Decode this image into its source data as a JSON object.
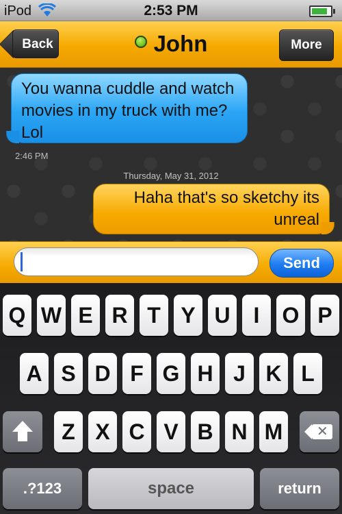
{
  "status_bar": {
    "carrier": "iPod",
    "time": "2:53 PM"
  },
  "nav": {
    "back_label": "Back",
    "title": "John",
    "more_label": "More",
    "status_color": "#5fc10f"
  },
  "messages": [
    {
      "direction": "incoming",
      "text": "You wanna cuddle and watch movies in my truck with me? Lol",
      "time": "2:46 PM"
    },
    {
      "direction": "outgoing",
      "text": "Haha that's so sketchy its unreal"
    }
  ],
  "date_separator": "Thursday, May 31, 2012",
  "compose": {
    "input_value": "",
    "send_label": "Send"
  },
  "keyboard": {
    "row1": [
      "Q",
      "W",
      "E",
      "R",
      "T",
      "Y",
      "U",
      "I",
      "O",
      "P"
    ],
    "row2": [
      "A",
      "S",
      "D",
      "F",
      "G",
      "H",
      "J",
      "K",
      "L"
    ],
    "row3": [
      "Z",
      "X",
      "C",
      "V",
      "B",
      "N",
      "M"
    ],
    "mode_label": ".?123",
    "space_label": "space",
    "return_label": "return"
  },
  "colors": {
    "accent_orange": "#f5a900",
    "incoming_bubble": "#2ba6f5",
    "send_blue": "#1f7cf2"
  }
}
